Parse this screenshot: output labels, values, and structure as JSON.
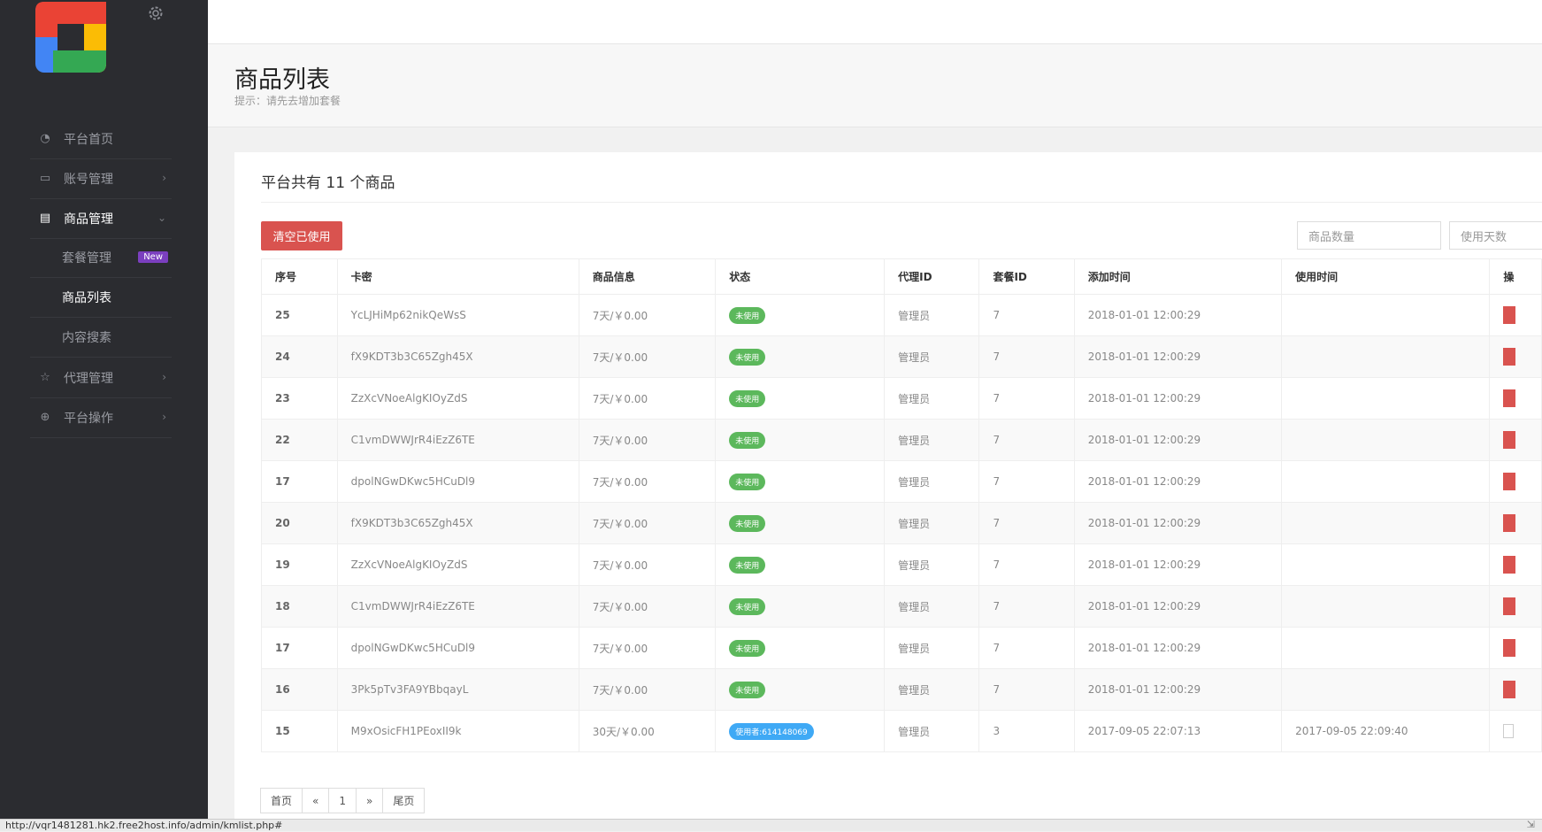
{
  "sidebar": {
    "items": [
      {
        "label": "平台首页",
        "icon": "dashboard-icon",
        "chevron": ""
      },
      {
        "label": "账号管理",
        "icon": "monitor-icon",
        "chevron": "›"
      },
      {
        "label": "商品管理",
        "icon": "list-icon",
        "chevron": "⌄"
      },
      {
        "label": "代理管理",
        "icon": "star-icon",
        "chevron": "›"
      },
      {
        "label": "平台操作",
        "icon": "globe-icon",
        "chevron": "›"
      }
    ],
    "subitems": [
      {
        "label": "套餐管理",
        "badge": "New"
      },
      {
        "label": "商品列表"
      },
      {
        "label": "内容搜素"
      }
    ]
  },
  "header": {
    "title": "商品列表",
    "tip": "提示：请先去增加套餐"
  },
  "main": {
    "summary": "平台共有 11 个商品",
    "clear_button": "清空已使用",
    "quantity_placeholder": "商品数量",
    "days_placeholder": "使用天数"
  },
  "table": {
    "headers": [
      "序号",
      "卡密",
      "商品信息",
      "状态",
      "代理ID",
      "套餐ID",
      "添加时间",
      "使用时间",
      "操"
    ],
    "rows": [
      {
        "id": "25",
        "key": "YcLJHiMp62nikQeWsS",
        "info": "7天/￥0.00",
        "status": "未使用",
        "agent": "管理员",
        "plan": "7",
        "added": "2018-01-01 12:00:29",
        "used": ""
      },
      {
        "id": "24",
        "key": "fX9KDT3b3C65Zgh45X",
        "info": "7天/￥0.00",
        "status": "未使用",
        "agent": "管理员",
        "plan": "7",
        "added": "2018-01-01 12:00:29",
        "used": ""
      },
      {
        "id": "23",
        "key": "ZzXcVNoeAlgKIOyZdS",
        "info": "7天/￥0.00",
        "status": "未使用",
        "agent": "管理员",
        "plan": "7",
        "added": "2018-01-01 12:00:29",
        "used": ""
      },
      {
        "id": "22",
        "key": "C1vmDWWJrR4iEzZ6TE",
        "info": "7天/￥0.00",
        "status": "未使用",
        "agent": "管理员",
        "plan": "7",
        "added": "2018-01-01 12:00:29",
        "used": ""
      },
      {
        "id": "17",
        "key": "dpolNGwDKwc5HCuDl9",
        "info": "7天/￥0.00",
        "status": "未使用",
        "agent": "管理员",
        "plan": "7",
        "added": "2018-01-01 12:00:29",
        "used": ""
      },
      {
        "id": "20",
        "key": "fX9KDT3b3C65Zgh45X",
        "info": "7天/￥0.00",
        "status": "未使用",
        "agent": "管理员",
        "plan": "7",
        "added": "2018-01-01 12:00:29",
        "used": ""
      },
      {
        "id": "19",
        "key": "ZzXcVNoeAlgKIOyZdS",
        "info": "7天/￥0.00",
        "status": "未使用",
        "agent": "管理员",
        "plan": "7",
        "added": "2018-01-01 12:00:29",
        "used": ""
      },
      {
        "id": "18",
        "key": "C1vmDWWJrR4iEzZ6TE",
        "info": "7天/￥0.00",
        "status": "未使用",
        "agent": "管理员",
        "plan": "7",
        "added": "2018-01-01 12:00:29",
        "used": ""
      },
      {
        "id": "17",
        "key": "dpolNGwDKwc5HCuDl9",
        "info": "7天/￥0.00",
        "status": "未使用",
        "agent": "管理员",
        "plan": "7",
        "added": "2018-01-01 12:00:29",
        "used": ""
      },
      {
        "id": "16",
        "key": "3Pk5pTv3FA9YBbqayL",
        "info": "7天/￥0.00",
        "status": "未使用",
        "agent": "管理员",
        "plan": "7",
        "added": "2018-01-01 12:00:29",
        "used": ""
      },
      {
        "id": "15",
        "key": "M9xOsicFH1PEoxII9k",
        "info": "30天/￥0.00",
        "status": "使用者:614148069",
        "agent": "管理员",
        "plan": "3",
        "added": "2017-09-05 22:07:13",
        "used": "2017-09-05 22:09:40"
      }
    ]
  },
  "pagination": [
    "首页",
    "«",
    "1",
    "»",
    "尾页"
  ],
  "statusbar": "http://vqr1481281.hk2.free2host.info/admin/kmlist.php#",
  "colors": {
    "sidebar_bg": "#2b2c30",
    "danger": "#d9534f",
    "success": "#5cb85c",
    "info": "#3fa9f5"
  }
}
